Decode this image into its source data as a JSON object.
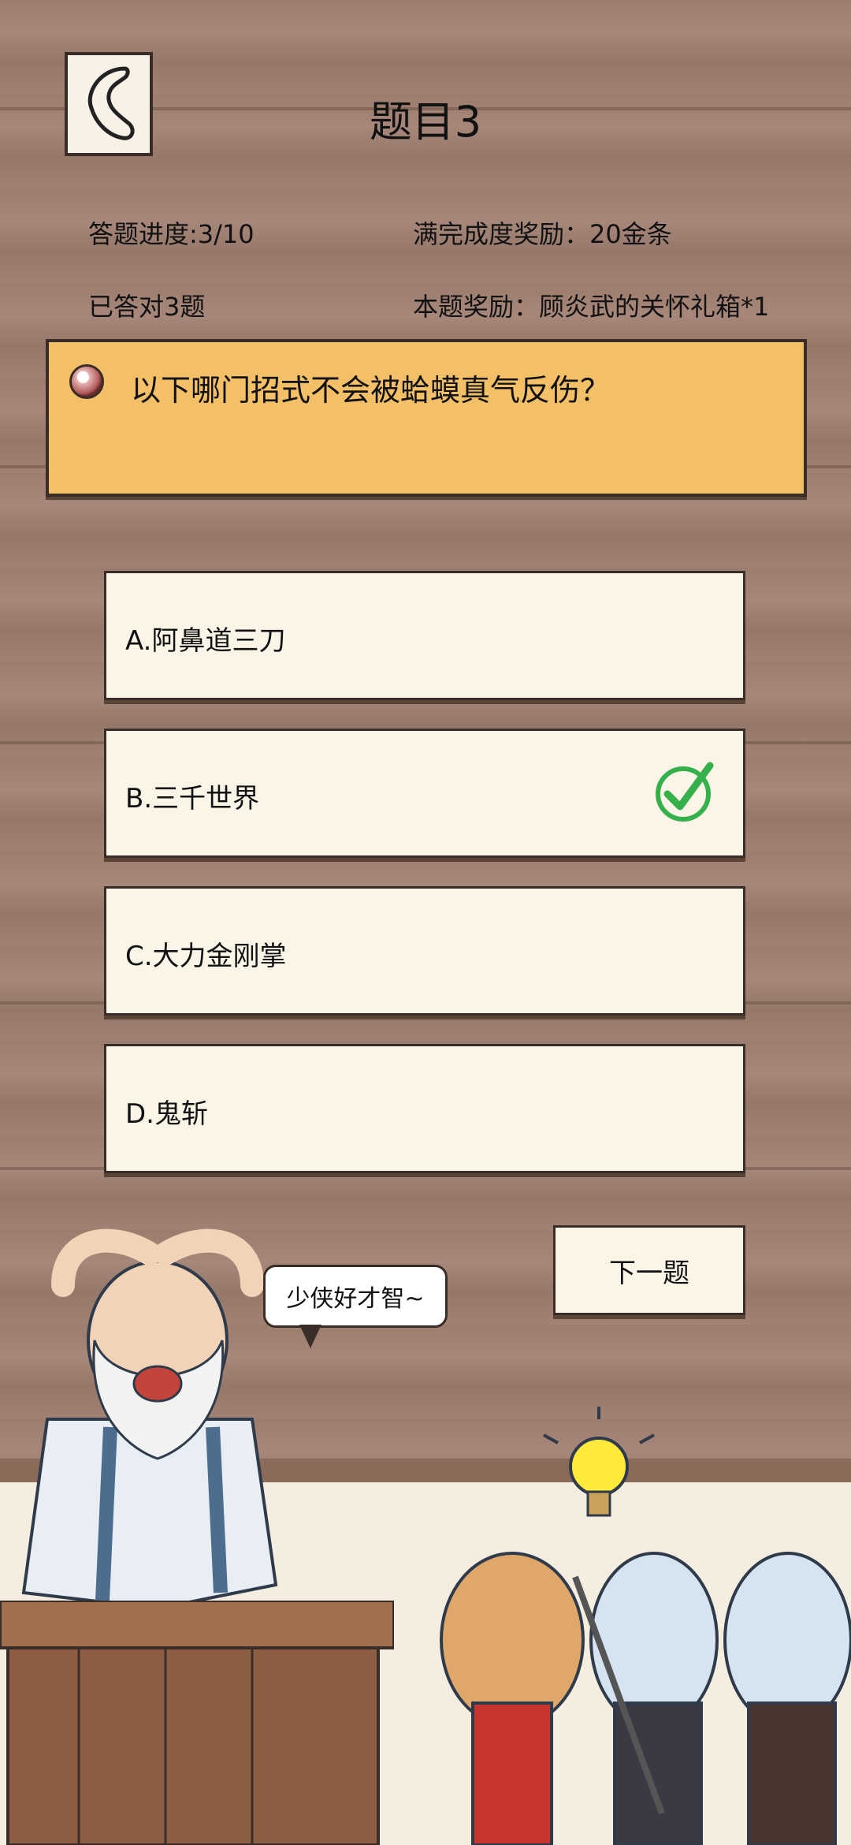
{
  "header": {
    "title": "题目3",
    "back_icon": "back-arrow-icon"
  },
  "stats": {
    "progress": "答题进度:3/10",
    "full_reward": "满完成度奖励：20金条",
    "correct_count": "已答对3题",
    "question_reward": "本题奖励：顾炎武的关怀礼箱*1"
  },
  "question": {
    "text": "以下哪门招式不会被蛤蟆真气反伤？"
  },
  "options": [
    {
      "label": "A.阿鼻道三刀",
      "selected": false
    },
    {
      "label": "B.三千世界",
      "selected": true
    },
    {
      "label": "C.大力金刚掌",
      "selected": false
    },
    {
      "label": "D.鬼斩",
      "selected": false
    }
  ],
  "next_button": {
    "label": "下一题"
  },
  "speech": {
    "text": "少侠好才智~"
  },
  "colors": {
    "banner": "#f3bf67",
    "check": "#35b04a",
    "wood": "#9c7c6c"
  }
}
